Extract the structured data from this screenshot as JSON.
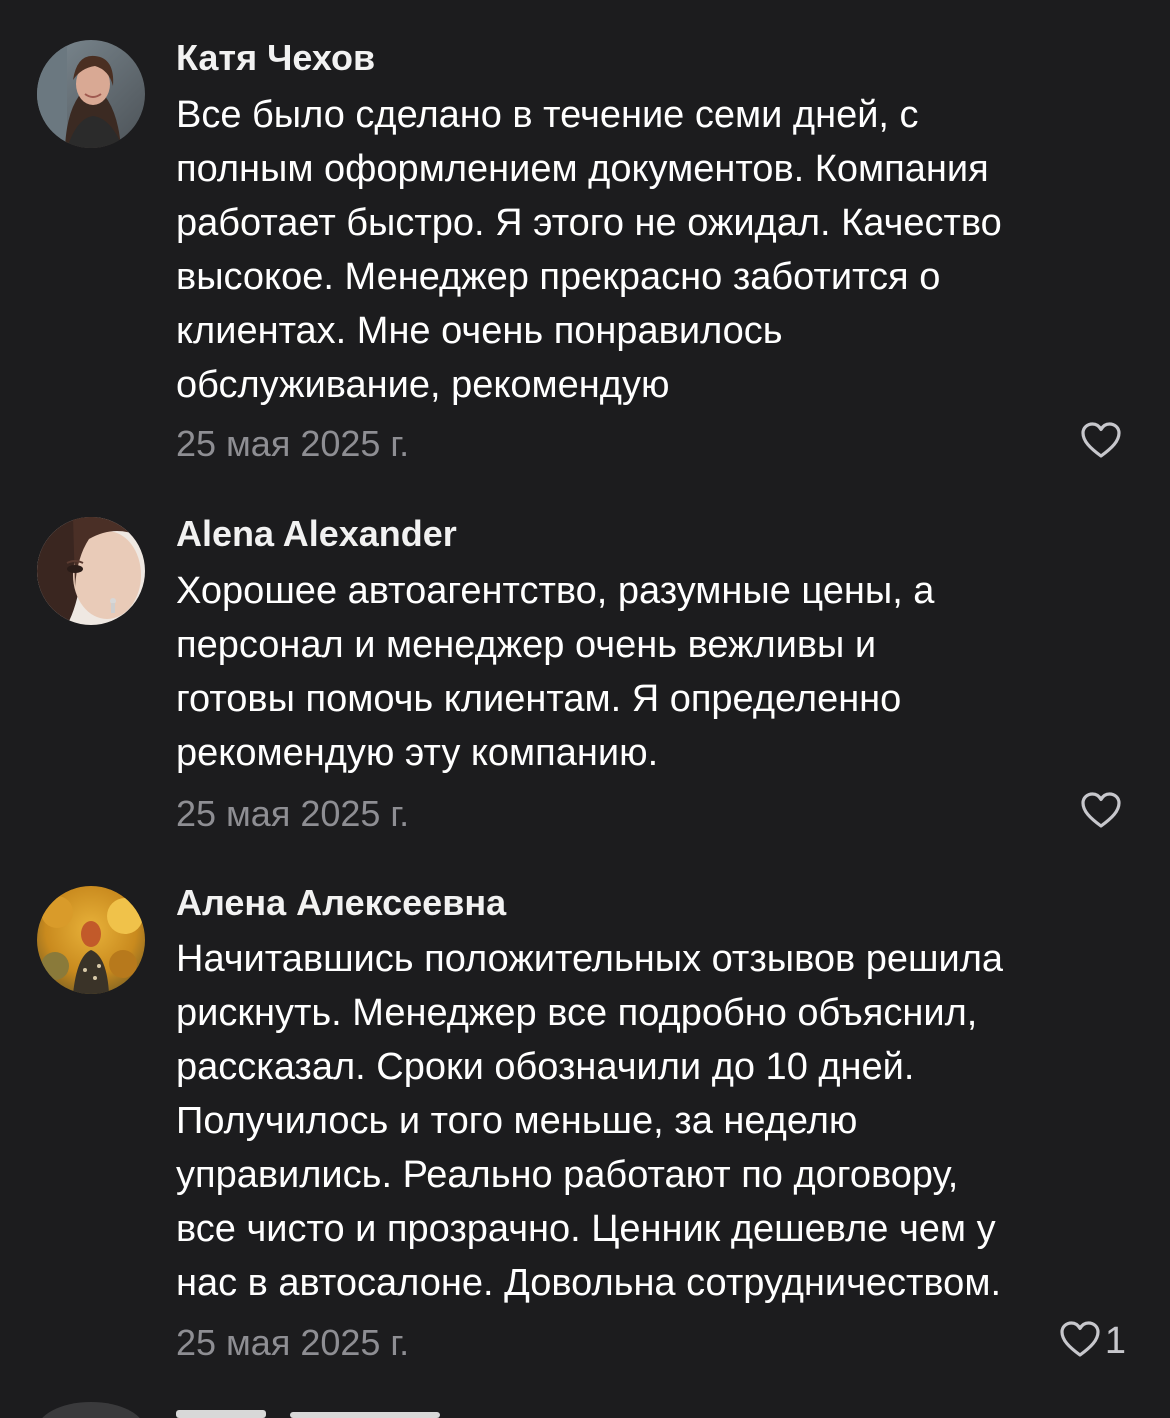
{
  "colors": {
    "background": "#1c1c1e",
    "author_text": "#f2f2f2",
    "body_text": "#ffffff",
    "date_text": "#8e8e93",
    "icon": "#c7c7cc"
  },
  "comments": [
    {
      "author": "Катя Чехов",
      "text_lines": [
        "Все было сделано в течение семи дней, с",
        "полным оформлением документов. Компания",
        "работает быстро. Я этого не ожидал. Качество",
        "высокое. Менеджер прекрасно заботится о",
        "клиентах. Мне очень понравилось",
        "обслуживание, рекомендую"
      ],
      "date": "25 мая 2025 г.",
      "like_icon": "heart-outline-icon",
      "like_count": ""
    },
    {
      "author": "Alena Alexander",
      "text_lines": [
        "Хорошее автоагентство, разумные цены, а",
        "персонал и менеджер очень вежливы и",
        "готовы помочь клиентам. Я определенно",
        "рекомендую эту компанию."
      ],
      "date": "25 мая 2025 г.",
      "like_icon": "heart-outline-icon",
      "like_count": ""
    },
    {
      "author": "Алена Алексеевна",
      "text_lines": [
        "Начитавшись положительных отзывов решила",
        "рискнуть. Менеджер все подробно объяснил,",
        "рассказал. Сроки обозначили до 10 дней.",
        "Получилось и того меньше, за неделю",
        "управились. Реально работают по договору,",
        "все чисто и прозрачно. Ценник дешевле чем у",
        "нас в автосалоне. Довольна сотрудничеством."
      ],
      "date": "25 мая 2025 г.",
      "like_icon": "heart-outline-icon",
      "like_count": "1"
    }
  ]
}
